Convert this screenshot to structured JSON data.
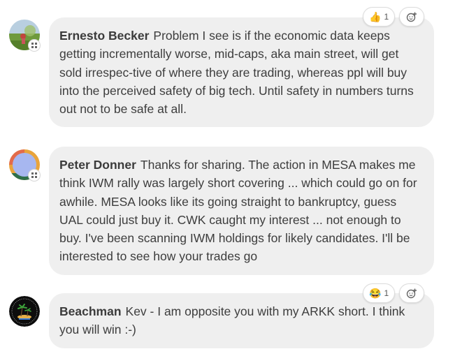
{
  "comments": [
    {
      "author": "Ernesto Becker",
      "text": "Problem I see is if the economic data keeps getting incrementally worse, mid-caps, aka main street, will get sold irrespec-tive of where they are trading, whereas ppl will buy into the perceived safety of big tech. Until safety in numbers turns out not to be safe at all.",
      "reaction": {
        "icon": "thumbs-up-icon",
        "count": "1"
      }
    },
    {
      "author": "Peter Donner",
      "text": "Thanks for sharing. The action in MESA makes me think IWM rally was largely short covering ... which could go on for awhile. MESA looks like its going straight to bankruptcy, guess UAL could just buy it. CWK caught my interest ... not enough to buy. I've been scanning IWM holdings for likely candidates. I'll be interested to see how your trades go"
    },
    {
      "author": "Beachman",
      "text": "Kev - I am opposite you with my ARKK short. I think you will win :-)",
      "reaction": {
        "icon": "laughing-icon",
        "count": "1"
      }
    }
  ],
  "colors": {
    "bubble_bg": "#efefef",
    "text": "#3d3d3d",
    "author": "#3b3b3b"
  }
}
